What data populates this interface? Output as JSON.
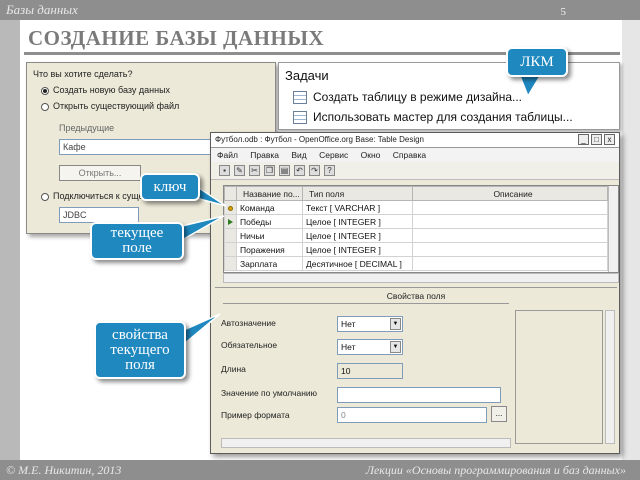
{
  "slide": {
    "section": "Базы данных",
    "page_number": "5",
    "title": "СОЗДАНИЕ БАЗЫ ДАННЫХ",
    "footer_left": "© М.Е. Никитин, 2013",
    "footer_right": "Лекции «Основы программирования и баз данных»"
  },
  "wizard": {
    "question": "Что вы хотите сделать?",
    "options": [
      "Создать новую базу данных",
      "Открыть существующий файл",
      "Подключиться к существующей"
    ],
    "recent_label": "Предыдущие",
    "recent_value": "Кафе",
    "open_button": "Открыть...",
    "connect_value": "JDBC"
  },
  "tasks": {
    "header": "Задачи",
    "items": [
      "Создать таблицу в режиме дизайна...",
      "Использовать мастер для создания таблицы..."
    ]
  },
  "window": {
    "title": "Футбол.odb : Футбол - OpenOffice.org Base: Table Design",
    "controls": [
      "_",
      "□",
      "x"
    ],
    "menu": [
      "Файл",
      "Правка",
      "Вид",
      "Сервис",
      "Окно",
      "Справка"
    ],
    "toolbar_icons": [
      "save-icon",
      "edit-icon",
      "cut-icon",
      "copy-icon",
      "paste-icon",
      "undo-icon",
      "redo-icon",
      "help-icon"
    ]
  },
  "grid": {
    "columns": [
      "Название по...",
      "Тип поля",
      "Описание"
    ],
    "rows": [
      {
        "name": "Команда",
        "type": "Текст [ VARCHAR ]",
        "marker": "key"
      },
      {
        "name": "Победы",
        "type": "Целое [ INTEGER ]",
        "marker": "current"
      },
      {
        "name": "Ничьи",
        "type": "Целое [ INTEGER ]",
        "marker": ""
      },
      {
        "name": "Поражения",
        "type": "Целое [ INTEGER ]",
        "marker": ""
      },
      {
        "name": "Зарплата",
        "type": "Десятичное [ DECIMAL ]",
        "marker": ""
      }
    ]
  },
  "properties": {
    "title": "Свойства поля",
    "autovalue_label": "Автозначение",
    "autovalue": "Нет",
    "required_label": "Обязательное",
    "required": "Нет",
    "length_label": "Длина",
    "length": "10",
    "default_label": "Значение по умолчанию",
    "default": "",
    "format_label": "Пример формата",
    "format": "0",
    "format_button": "..."
  },
  "callouts": {
    "lkm": "ЛКМ",
    "key": "ключ",
    "current_field": "текущее поле",
    "field_props": "свойства текущего поля"
  },
  "colors": {
    "callout": "#1f88bf",
    "highlight": "#e2231a",
    "frame": "#8e8e8e"
  }
}
